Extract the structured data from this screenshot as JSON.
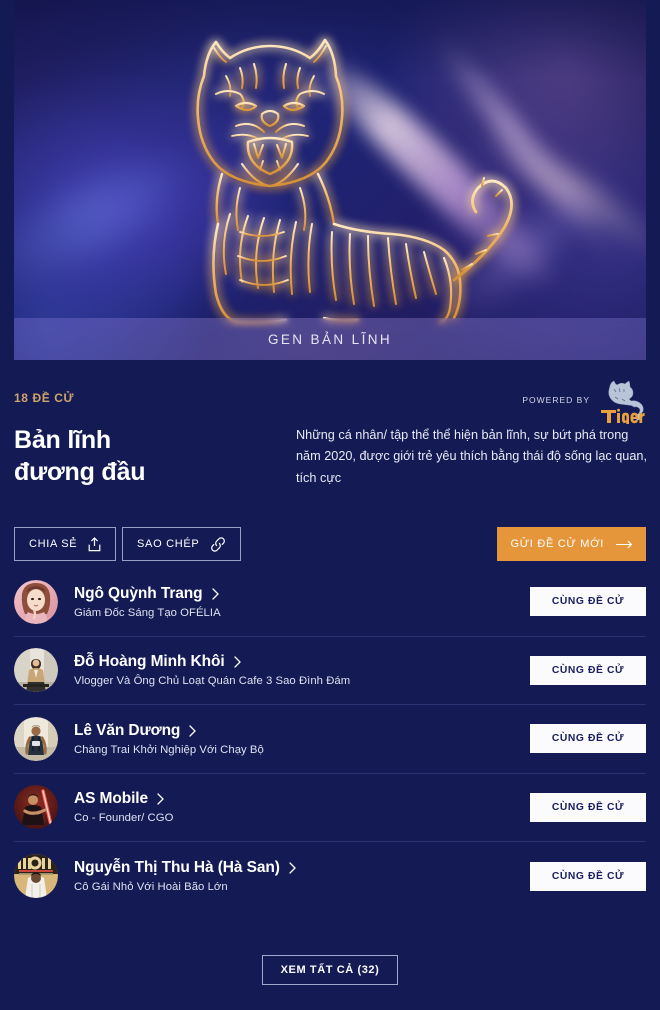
{
  "hero": {
    "caption": "GEN BẢN LĨNH",
    "artwork_name": "neon-tiger-illustration"
  },
  "meta": {
    "count_label": "18 ĐỀ CỬ",
    "powered_by_text": "POWERED BY",
    "brand_name": "Tiger"
  },
  "header": {
    "title_line1": "Bản lĩnh",
    "title_line2": "đương đầu",
    "description": "Những cá nhân/ tập thể thể hiện bản lĩnh, sự bứt phá trong năm 2020, được giới trẻ yêu thích bằng thái độ sống lạc quan, tích cực"
  },
  "actions": {
    "share_label": "CHIA SẺ",
    "copy_label": "SAO CHÉP",
    "submit_label": "GỬI ĐỀ CỬ MỚI"
  },
  "nominees": [
    {
      "name": "Ngô Quỳnh Trang",
      "subtitle": "Giám Đốc Sáng Tạo OFÉLIA",
      "nominate_label": "CÙNG ĐỀ CỬ",
      "avatar_name": "avatar-ngo-quynh-trang"
    },
    {
      "name": "Đỗ Hoàng Minh Khôi",
      "subtitle": "Vlogger Và Ông Chủ Loạt Quán Cafe 3 Sao Đình Đám",
      "nominate_label": "CÙNG ĐỀ CỬ",
      "avatar_name": "avatar-do-hoang-minh-khoi"
    },
    {
      "name": "Lê Văn Dương",
      "subtitle": "Chàng Trai Khởi Nghiệp Với Chạy Bộ",
      "nominate_label": "CÙNG ĐỀ CỬ",
      "avatar_name": "avatar-le-van-duong"
    },
    {
      "name": "AS Mobile",
      "subtitle": "Co - Founder/ CGO",
      "nominate_label": "CÙNG ĐỀ CỬ",
      "avatar_name": "avatar-as-mobile"
    },
    {
      "name": "Nguyễn Thị Thu Hà (Hà San)",
      "subtitle": "Cô Gái Nhỏ Với Hoài Bão Lớn",
      "nominate_label": "CÙNG ĐỀ CỬ",
      "avatar_name": "avatar-nguyen-thi-thu-ha"
    }
  ],
  "footer": {
    "view_all_label": "XEM TẤT CẢ (32)"
  },
  "colors": {
    "page_background": "#131a54",
    "accent_orange": "#e5963a",
    "gold_text": "#cfa469",
    "divider": "#2b3171",
    "white": "#ffffff"
  }
}
